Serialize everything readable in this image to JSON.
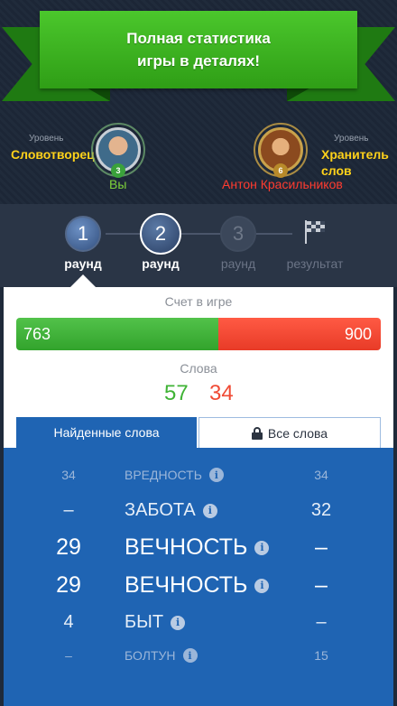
{
  "banner": {
    "text": "Полная статистика\nигры в деталях!"
  },
  "players": {
    "me": {
      "level_label": "Уровень",
      "level_name": "Словотворец",
      "level_number": "3",
      "name": "Вы",
      "name_color": "#7fd43a"
    },
    "opponent": {
      "level_label": "Уровень",
      "level_name": "Хранитель\nслов",
      "level_number": "6",
      "name": "Антон Красильников",
      "name_color": "#ff3b2f"
    }
  },
  "steps": [
    {
      "number": "1",
      "label": "раунд",
      "state": "done"
    },
    {
      "number": "2",
      "label": "раунд",
      "state": "active"
    },
    {
      "number": "3",
      "label": "раунд",
      "state": "future"
    },
    {
      "number": "",
      "label": "результат",
      "state": "future",
      "icon": "checkered-flag-icon"
    }
  ],
  "score": {
    "title": "Счет в игре",
    "left": "763",
    "right": "900",
    "left_color": "#3db335",
    "right_color": "#f04a34"
  },
  "words_count": {
    "title": "Слова",
    "left": "57",
    "right": "34"
  },
  "tabs": {
    "found": "Найденные слова",
    "all": "Все слова"
  },
  "words": [
    {
      "left": "34",
      "word": "ВРЕДНОСТЬ",
      "right": "34",
      "style": "dim"
    },
    {
      "left": "–",
      "word": "ЗАБОТА",
      "right": "32",
      "style": "mid"
    },
    {
      "left": "29",
      "word": "ВЕЧНОСТЬ",
      "right": "–",
      "style": "big"
    },
    {
      "left": "29",
      "word": "ВЕЧНОСТЬ",
      "right": "–",
      "style": "big"
    },
    {
      "left": "4",
      "word": "БЫТ",
      "right": "–",
      "style": "mid"
    },
    {
      "left": "–",
      "word": "БОЛТУН",
      "right": "15",
      "style": "dim"
    }
  ]
}
